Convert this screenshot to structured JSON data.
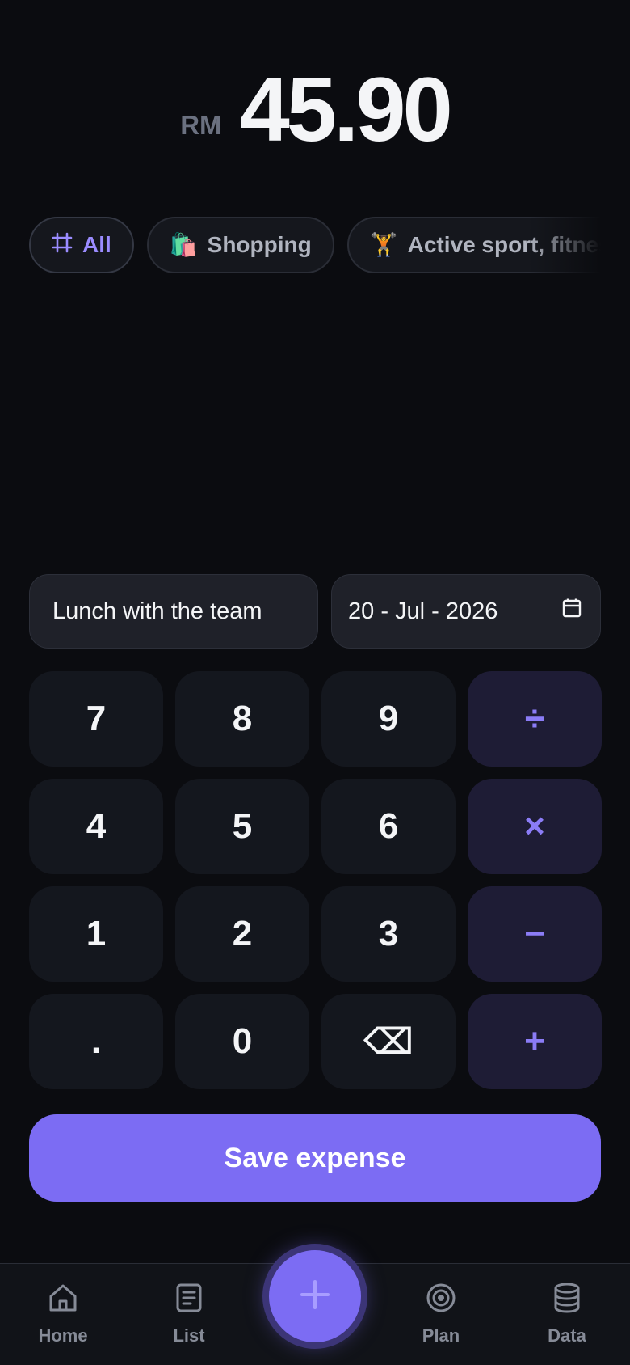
{
  "amount": {
    "currency": "RM",
    "value": "45.90"
  },
  "categories": [
    {
      "label": "All",
      "icon": "grid-hash-icon",
      "active": true
    },
    {
      "label": "Shopping",
      "icon": "shopping-bag-emoji",
      "emoji": "🛍️",
      "active": false
    },
    {
      "label": "Active sport, fitness",
      "icon": "weightlifter-emoji",
      "emoji": "🏋️",
      "active": false
    }
  ],
  "note": {
    "value": "Lunch with the team"
  },
  "date": {
    "value": "20 - Jul - 2026",
    "icon": "calendar-icon"
  },
  "keypad": {
    "rows": [
      [
        "7",
        "8",
        "9",
        "÷"
      ],
      [
        "4",
        "5",
        "6",
        "×"
      ],
      [
        "1",
        "2",
        "3",
        "−"
      ],
      [
        ".",
        "0",
        "⌫",
        "+"
      ]
    ]
  },
  "save_label": "Save expense",
  "nav": {
    "items": [
      {
        "label": "Home",
        "icon": "home-icon"
      },
      {
        "label": "List",
        "icon": "list-icon"
      },
      {
        "label": "Plan",
        "icon": "target-icon"
      },
      {
        "label": "Data",
        "icon": "database-icon"
      }
    ],
    "fab_icon": "plus-icon"
  },
  "colors": {
    "background": "#0b0c10",
    "accent": "#7c6cf3",
    "key": "#14171e",
    "operator_key": "#1e1c35",
    "operator_text": "#8b7cf6"
  }
}
